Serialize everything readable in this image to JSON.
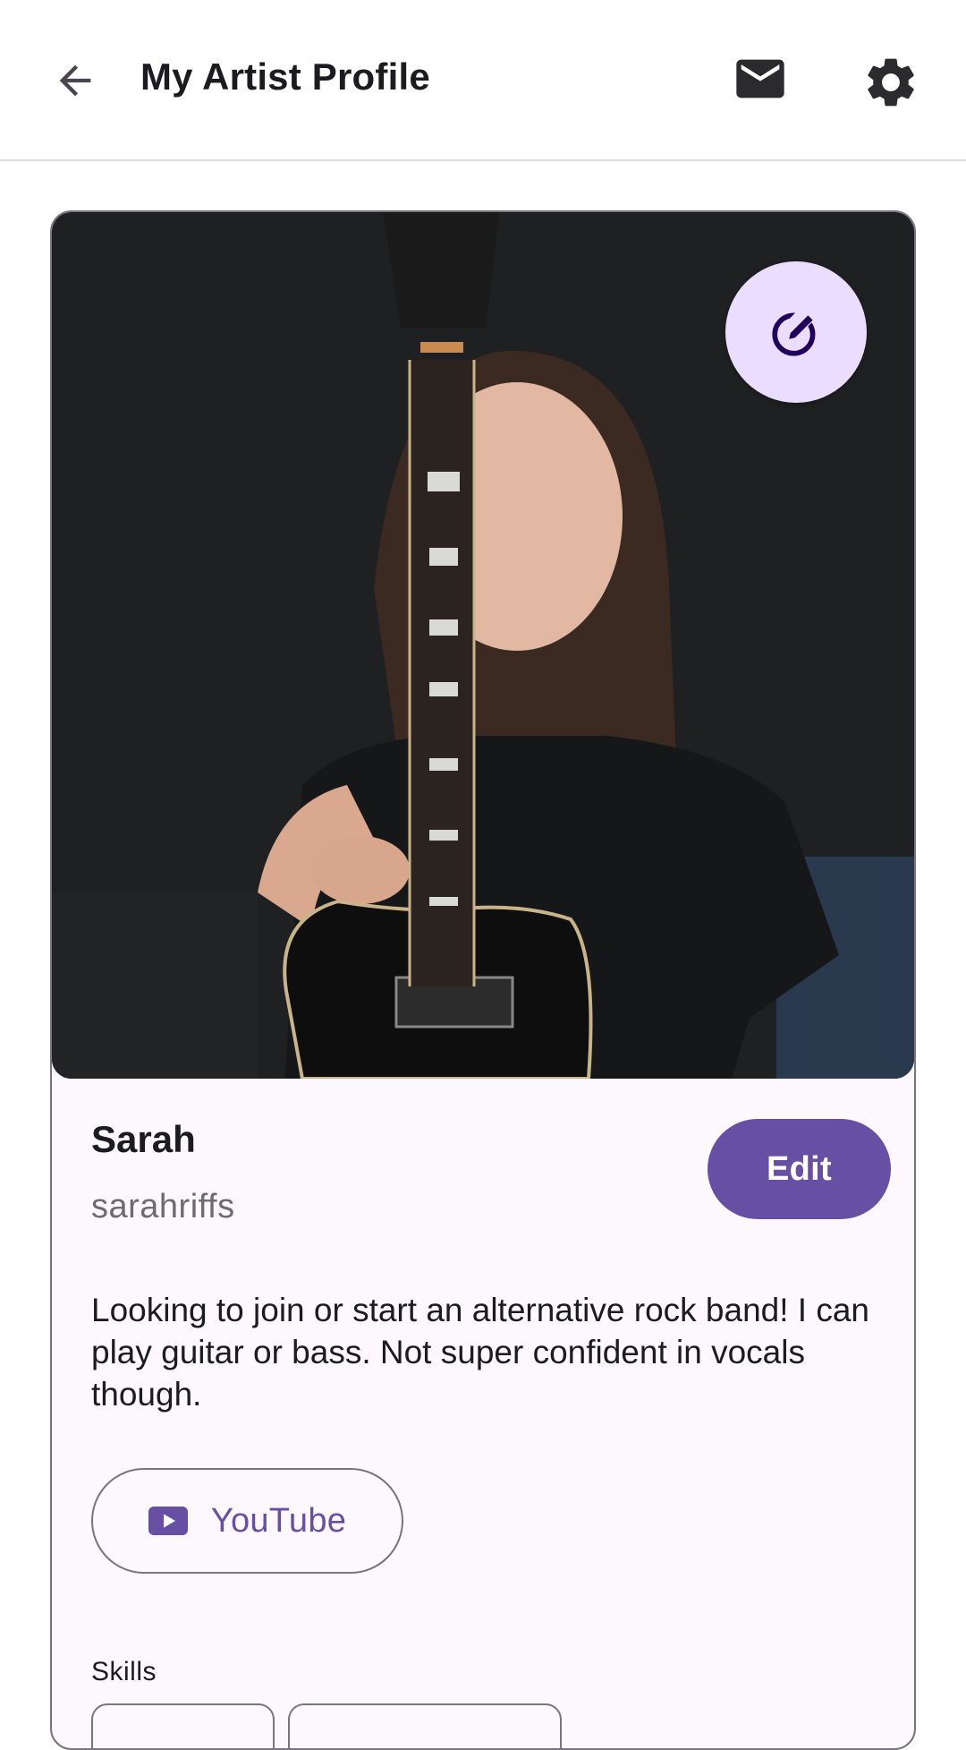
{
  "header": {
    "title": "My Artist Profile"
  },
  "profile": {
    "name": "Sarah",
    "handle": "sarahriffs",
    "bio": "Looking to join or start an alternative rock band! I can play guitar or bass. Not super confident in vocals though.",
    "edit_label": "Edit",
    "links": [
      {
        "label": "YouTube",
        "icon": "youtube-icon"
      }
    ],
    "skills_label": "Skills"
  },
  "colors": {
    "primary": "#6750a4",
    "primary_container": "#eaddff",
    "on_primary_container": "#21005d",
    "surface": "#fdf8fd",
    "outline": "#79747e"
  },
  "icons": [
    "arrow-back-icon",
    "mail-icon",
    "settings-gear-icon",
    "edit-pencil-icon",
    "youtube-icon"
  ]
}
